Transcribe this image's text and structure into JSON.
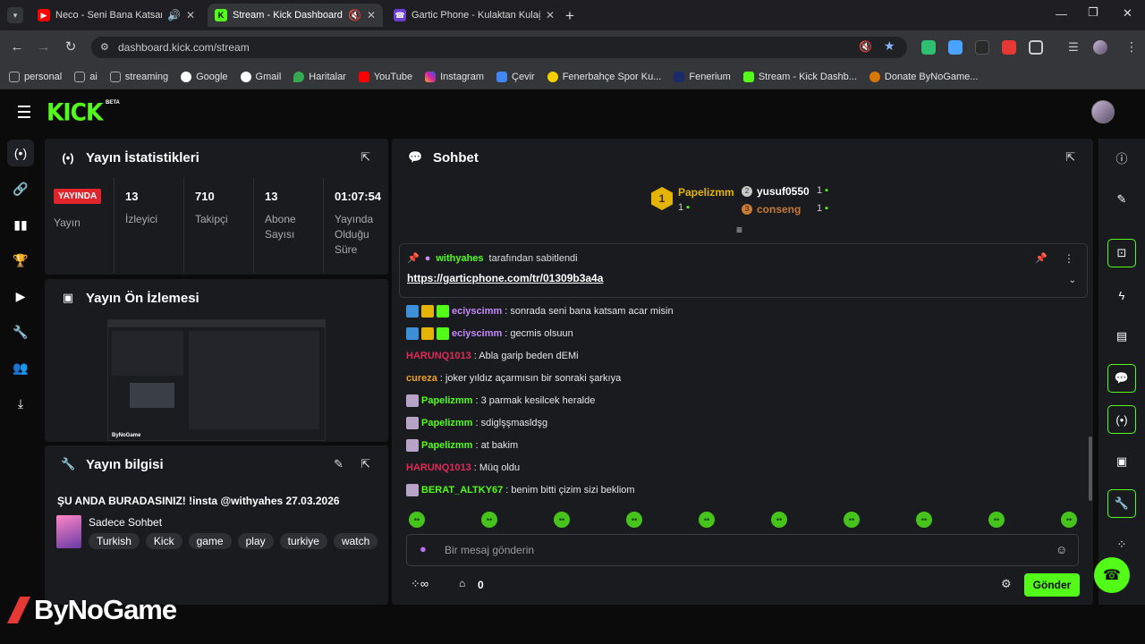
{
  "browser": {
    "tabs": [
      {
        "title": "Neco - Seni Bana Katsam -",
        "icon": "youtube-icon",
        "extra": "speaker-icon"
      },
      {
        "title": "Stream - Kick Dashboard",
        "icon": "kick-icon",
        "extra": "muted-speaker-icon"
      },
      {
        "title": "Gartic Phone - Kulaktan Kulağa",
        "icon": "phone-icon",
        "extra": ""
      }
    ],
    "url": "dashboard.kick.com/stream",
    "bookmarks": [
      "personal",
      "ai",
      "streaming",
      "Google",
      "Gmail",
      "Haritalar",
      "YouTube",
      "Instagram",
      "Çevir",
      "Fenerbahçe Spor Ku...",
      "Fenerium",
      "Stream - Kick Dashb...",
      "Donate ByNoGame..."
    ]
  },
  "brand": {
    "logo": "KICK",
    "beta": "BETA",
    "accent": "#53fc18"
  },
  "stats": {
    "title": "Yayın İstatistikleri",
    "live_badge": "YAYINDA",
    "live_label": "Yayın",
    "viewers": {
      "value": "13",
      "label": "İzleyici"
    },
    "followers": {
      "value": "710",
      "label": "Takipçi"
    },
    "subs": {
      "value": "13",
      "label": "Abone Sayısı"
    },
    "uptime": {
      "value": "01:07:54",
      "label": "Yayında Olduğu Süre"
    }
  },
  "preview": {
    "title": "Yayın Ön İzlemesi"
  },
  "info": {
    "title": "Yayın bilgisi",
    "stream_title": "ŞU ANDA BURADASINIZ! !insta @withyahes 27.03.2026",
    "category": "Sadece Sohbet",
    "tags": [
      "Turkish",
      "Kick",
      "game",
      "play",
      "turkiye",
      "watch"
    ]
  },
  "chat": {
    "title": "Sohbet",
    "leaderboard": [
      {
        "rank": "1",
        "name": "Papelizmm",
        "count": "1"
      },
      {
        "rank": "2",
        "name": "yusuf0550",
        "count": "1"
      },
      {
        "rank": "3",
        "name": "conseng",
        "count": "1"
      }
    ],
    "pinned": {
      "by": "withyahes",
      "by_suffix": "tarafından sabitlendi",
      "link": "https://garticphone.com/tr/01309b3a4a"
    },
    "messages": [
      {
        "user": "eciyscimm",
        "text": ": sonrada seni bana katsam acar misin",
        "color": "#c58af9"
      },
      {
        "user": "eciyscimm",
        "text": ": gecmis olsuun",
        "color": "#c58af9"
      },
      {
        "user": "HARUNQ1013",
        "text": ": Abla garip beden dEMi",
        "color": "#e02b5b"
      },
      {
        "user": "cureza",
        "text": ": joker yıldız açarmısın bir sonraki şarkıya",
        "color": "#f0a020"
      },
      {
        "user": "Papelizmm",
        "text": ": 3 parmak kesilcek heralde",
        "color": "#53fc18"
      },
      {
        "user": "Papelizmm",
        "text": ": sdiglşşmasldşg",
        "color": "#53fc18"
      },
      {
        "user": "Papelizmm",
        "text": ": at bakim",
        "color": "#53fc18"
      },
      {
        "user": "HARUNQ1013",
        "text": ": Müq oldu",
        "color": "#e02b5b"
      },
      {
        "user": "BERAT_ALTKY67",
        "text": ": benim bitti çizim sizi bekliom",
        "color": "#53fc18"
      }
    ],
    "placeholder": "Bir mesaj gönderin",
    "points": "0",
    "send_label": "Gönder"
  },
  "watermark": "ByNoGame"
}
